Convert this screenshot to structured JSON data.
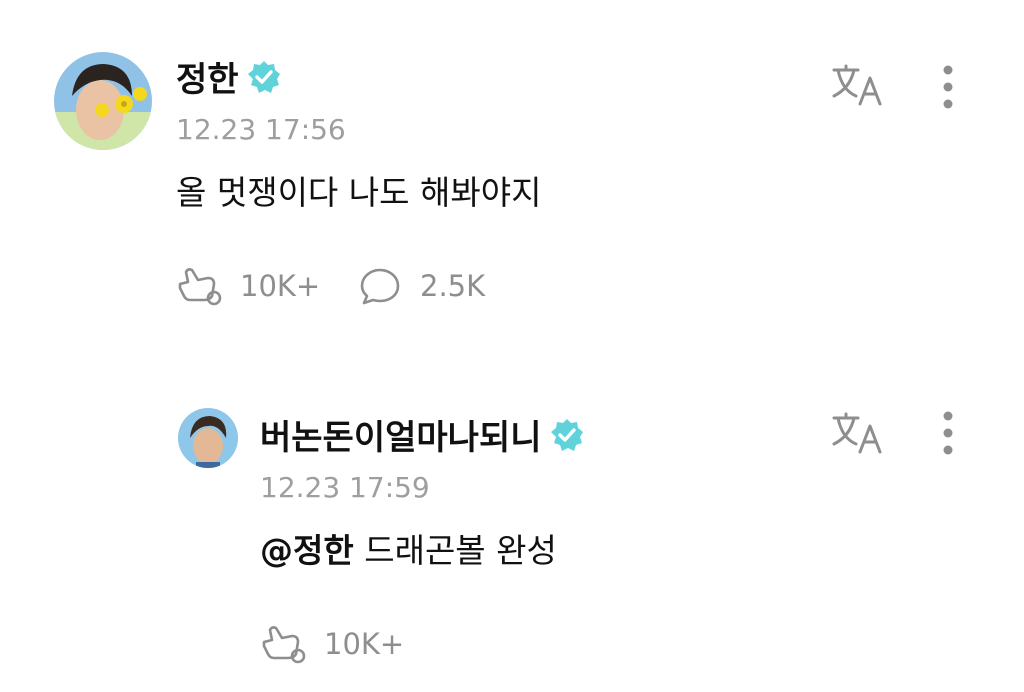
{
  "colors": {
    "verified": "#5fd3d9",
    "muted_text": "#9e9e9e",
    "icon_gray": "#8e8e8e",
    "text": "#111111"
  },
  "post": {
    "author": "정한",
    "time": "12.23 17:56",
    "text": "올 멋쟁이다 나도 해봐야지",
    "likes": "10K+",
    "comments": "2.5K",
    "icons": [
      "translate-icon",
      "more-vertical-icon",
      "like-hand-icon",
      "comment-bubble-icon",
      "verified-badge-icon"
    ]
  },
  "reply": {
    "author": "버논돈이얼마나되니",
    "time": "12.23 17:59",
    "mention": "@정한",
    "text": " 드래곤볼 완성",
    "likes": "10K+",
    "icons": [
      "translate-icon",
      "more-vertical-icon",
      "like-hand-icon",
      "verified-badge-icon"
    ]
  }
}
